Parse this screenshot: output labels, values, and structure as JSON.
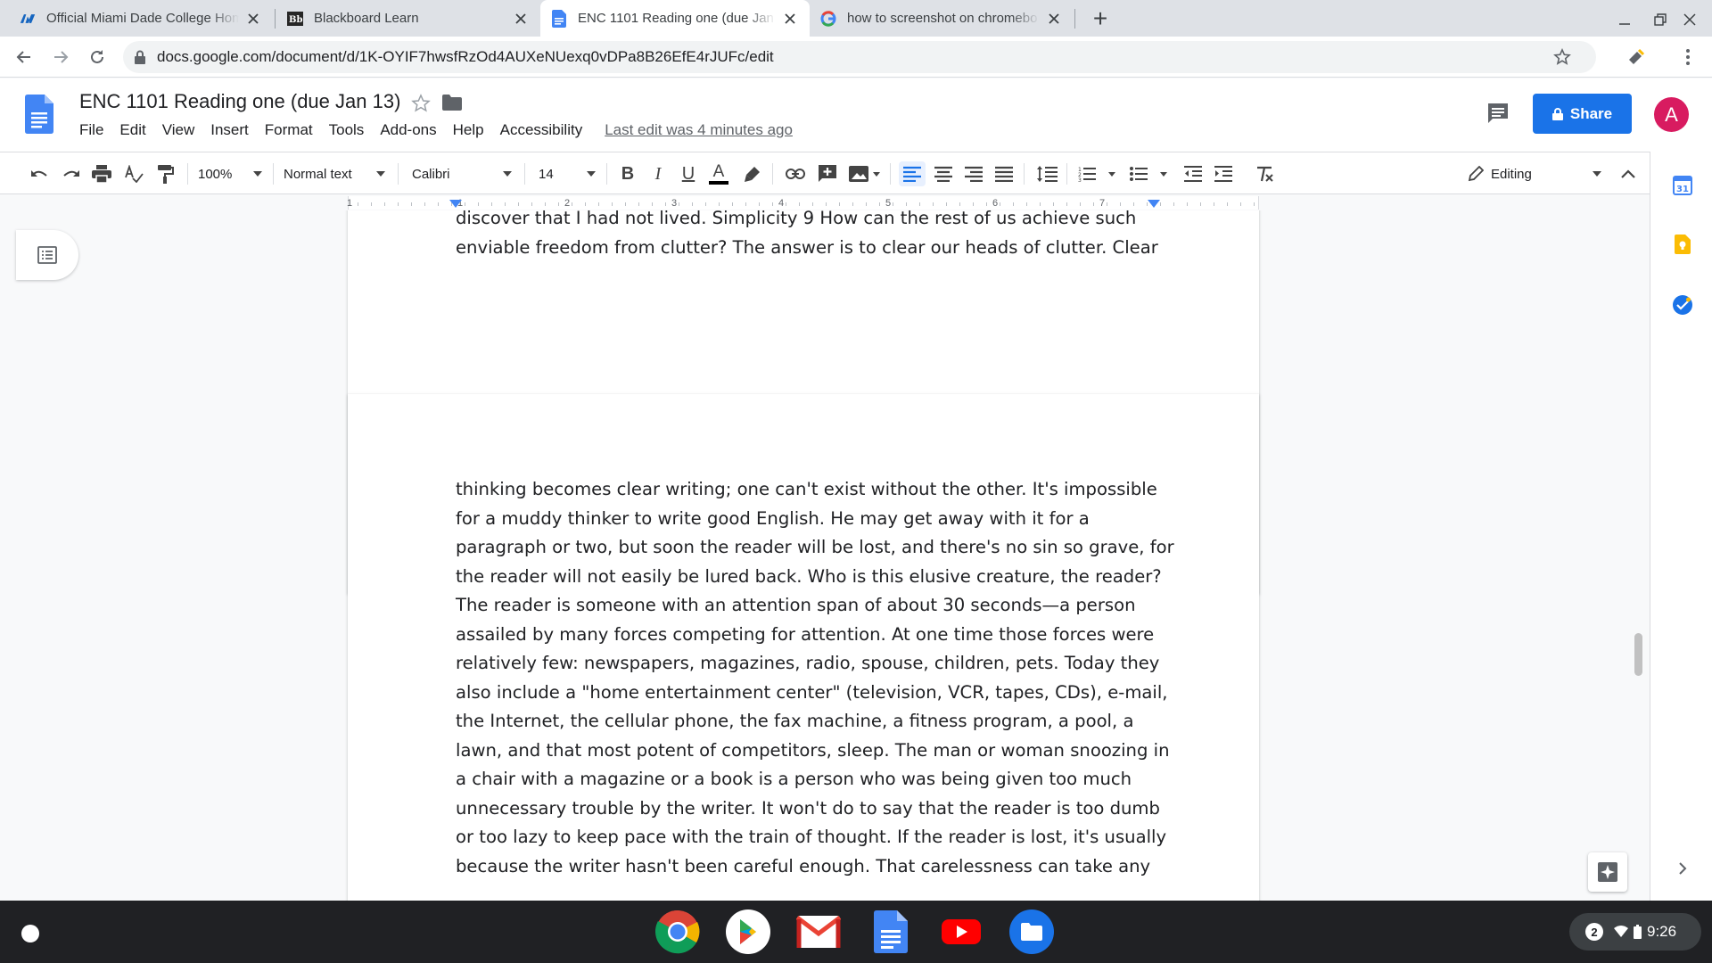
{
  "browser": {
    "tabs": [
      {
        "title": "Official Miami Dade College Hom",
        "favicon": "mdc-logo-icon"
      },
      {
        "title": "Blackboard Learn",
        "favicon": "blackboard-icon"
      },
      {
        "title": "ENC 1101 Reading one (due Jan",
        "favicon": "docs-icon",
        "active": true
      },
      {
        "title": "how to screenshot on chromebo",
        "favicon": "google-icon"
      }
    ],
    "new_tab": "+",
    "url": "docs.google.com/document/d/1K-OYIF7hwsfRzOd4AUXeNUexq0vDPa8B26EfE4rJUFc/edit"
  },
  "docs": {
    "title": "ENC 1101 Reading one (due Jan 13)",
    "menu": [
      "File",
      "Edit",
      "View",
      "Insert",
      "Format",
      "Tools",
      "Add-ons",
      "Help",
      "Accessibility"
    ],
    "last_edit": "Last edit was 4 minutes ago",
    "share_label": "Share",
    "avatar_letter": "A",
    "brand_color": "#1a73e8"
  },
  "toolbar": {
    "zoom": "100%",
    "style": "Normal text",
    "font": "Calibri",
    "size": "14",
    "mode": "Editing"
  },
  "ruler": {
    "numbers": [
      "1",
      "1",
      "2",
      "3",
      "4",
      "5",
      "6",
      "7"
    ]
  },
  "document": {
    "page1_lines": [
      "discover that I had not lived. Simplicity 9 How can the rest of us achieve such",
      "enviable freedom from clutter? The answer is to clear our heads of clutter. Clear"
    ],
    "page2_lines": [
      "thinking becomes clear writing; one can't exist without the other. It's impossible",
      "for a muddy thinker to write good English. He may get away with it for a",
      "paragraph or two, but soon the reader will be lost, and there's no sin so grave, for",
      "the reader will not easily be lured back. Who is this elusive creature, the reader?",
      "The reader is someone with an attention span of about 30 seconds—a person",
      "assailed by many forces competing for attention. At one time those forces were",
      "relatively few: newspapers, magazines, radio, spouse, children, pets. Today they",
      "also include a \"home entertainment center\" (television, VCR, tapes, CDs), e-mail,",
      "the Internet, the cellular phone, the fax machine, a fitness program, a pool, a",
      "lawn, and that most potent of competitors, sleep. The man or woman snoozing in",
      "a chair with a magazine or a book is a person who was being given too much",
      "unnecessary trouble by the writer. It won't do to say that the reader is too dumb",
      "or too lazy to keep pace with the train of thought. If the reader is lost, it's usually",
      "because the writer hasn't been careful enough. That carelessness can take any"
    ]
  },
  "side_panel": {
    "calendar_day": "31"
  },
  "shelf": {
    "apps": [
      "chrome-icon",
      "play-store-icon",
      "gmail-icon",
      "docs-icon",
      "youtube-icon",
      "files-icon"
    ],
    "notification_count": "2",
    "time": "9:26"
  }
}
